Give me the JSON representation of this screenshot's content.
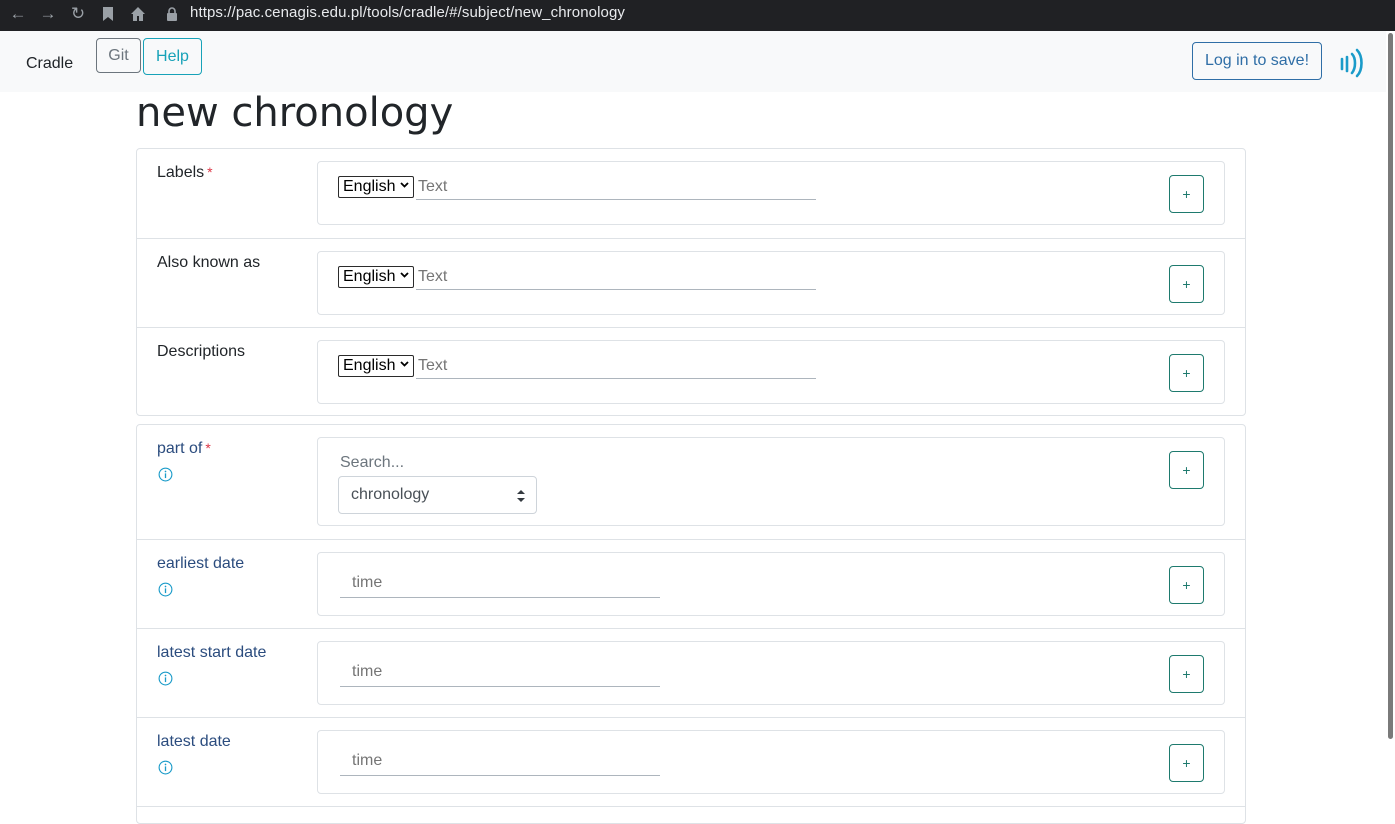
{
  "browser": {
    "url": "https://pac.cenagis.edu.pl/tools/cradle/#/subject/new_chronology"
  },
  "navbar": {
    "brand": "Cradle",
    "git_label": "Git",
    "help_label": "Help",
    "login_label": "Log in to save!"
  },
  "page": {
    "title": "new chronology"
  },
  "multilingual_fields": [
    {
      "label": "Labels",
      "required": "*",
      "language": "English",
      "placeholder": "Text",
      "add": "+"
    },
    {
      "label": "Also known as",
      "required": "",
      "language": "English",
      "placeholder": "Text",
      "add": "+"
    },
    {
      "label": "Descriptions",
      "required": "",
      "language": "English",
      "placeholder": "Text",
      "add": "+"
    }
  ],
  "part_of": {
    "label": "part of",
    "required": "*",
    "search_placeholder": "Search...",
    "selected": "chronology",
    "add": "+"
  },
  "date_fields": [
    {
      "label": "earliest date",
      "placeholder": "time",
      "add": "+"
    },
    {
      "label": "latest start date",
      "placeholder": "time",
      "add": "+"
    },
    {
      "label": "latest date",
      "placeholder": "time",
      "add": "+"
    }
  ],
  "colors": {
    "accent_teal": "#17a2b8",
    "add_button": "#1e7a6e",
    "required": "#dc3545",
    "property_label": "#2b4c7e"
  }
}
